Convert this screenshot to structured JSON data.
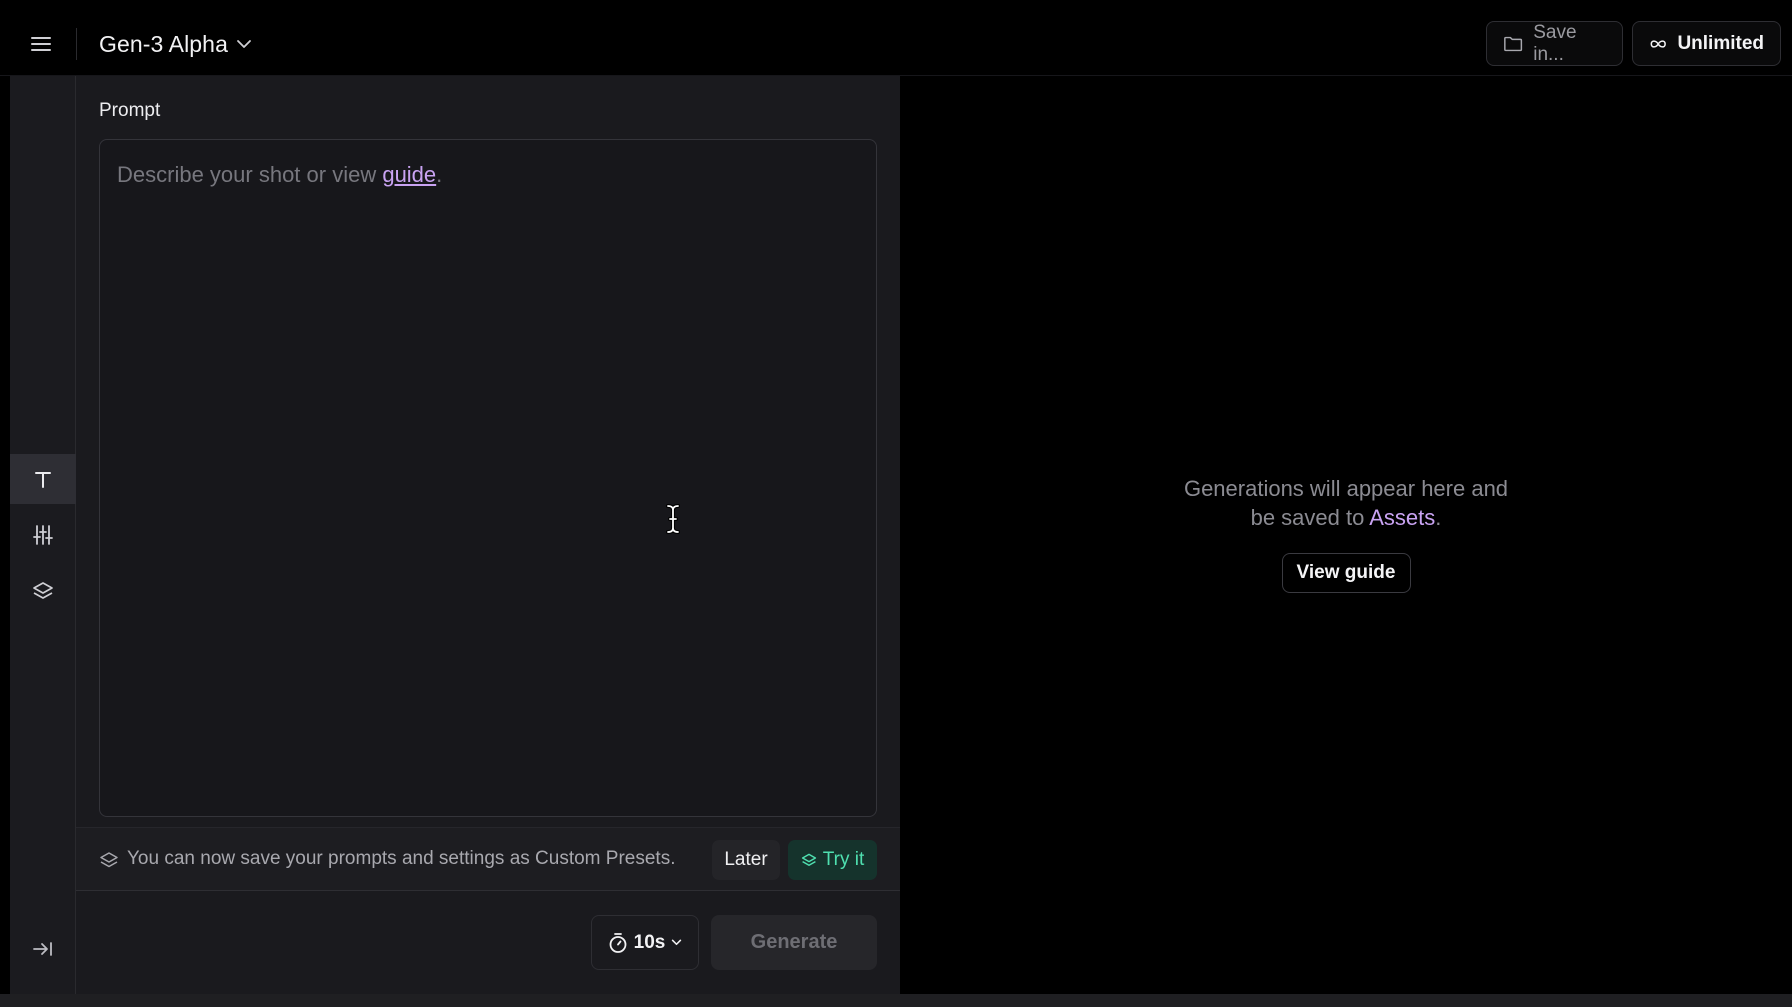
{
  "header": {
    "model_name": "Gen-3 Alpha",
    "save_label": "Save in...",
    "plan_label": "Unlimited"
  },
  "rail": {
    "items": [
      {
        "icon": "text-icon",
        "active": true
      },
      {
        "icon": "sliders-icon",
        "active": false
      },
      {
        "icon": "layers-icon",
        "active": false
      }
    ],
    "collapse_icon": "collapse-panel-icon"
  },
  "prompt": {
    "label": "Prompt",
    "placeholder_prefix": "Describe your shot or view ",
    "placeholder_link": "guide",
    "placeholder_suffix": "."
  },
  "preset_banner": {
    "message": "You can now save your prompts and settings as Custom Presets.",
    "later_label": "Later",
    "try_label": "Try it"
  },
  "controls": {
    "duration": "10s",
    "generate_label": "Generate"
  },
  "output": {
    "line1": "Generations will appear here and",
    "line2_prefix": "be saved to ",
    "line2_link": "Assets",
    "line2_suffix": ".",
    "guide_button": "View guide"
  },
  "colors": {
    "accent_link": "#c9a3f2",
    "try_it_green": "#4fe0b0",
    "panel_bg": "#1a1a1e"
  }
}
